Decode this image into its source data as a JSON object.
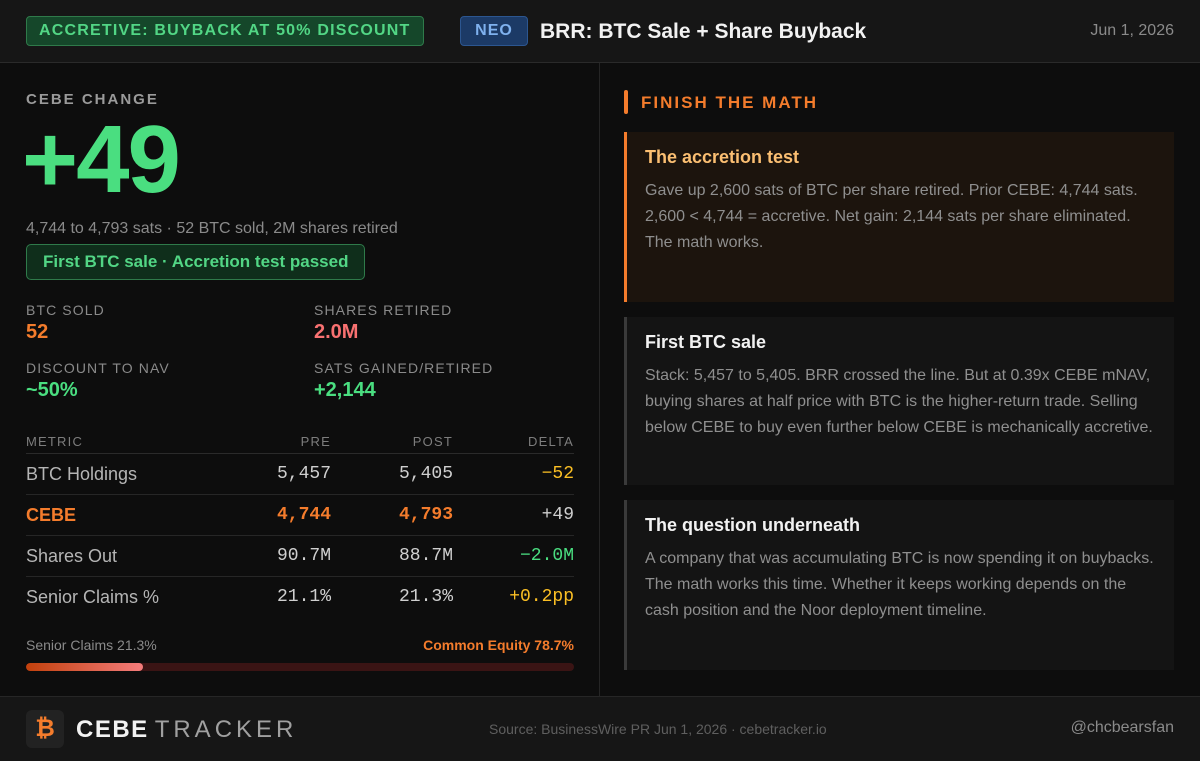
{
  "header": {
    "badge": "ACCRETIVE: BUYBACK AT 50% DISCOUNT",
    "ticker": "NEO",
    "title": "BRR: BTC Sale + Share Buyback",
    "date": "Jun 1, 2026"
  },
  "summary": {
    "label": "CEBE CHANGE",
    "value": "+49",
    "subtitle": "4,744 to 4,793 sats · 52 BTC sold, 2M shares retired",
    "pill": "First BTC sale · Accretion test passed"
  },
  "stats": [
    {
      "label": "BTC SOLD",
      "value": "52",
      "color": "#f47c2c"
    },
    {
      "label": "SHARES RETIRED",
      "value": "2.0M",
      "color": "#f87171"
    },
    {
      "label": "DISCOUNT TO NAV",
      "value": "~50%",
      "color": "#4ade80"
    },
    {
      "label": "SATS GAINED/RETIRED",
      "value": "+2,144",
      "color": "#4ade80"
    }
  ],
  "table": {
    "headers": {
      "metric": "METRIC",
      "pre": "PRE",
      "post": "POST",
      "delta": "DELTA"
    },
    "rows": [
      {
        "metric": "BTC Holdings",
        "pre": "5,457",
        "post": "5,405",
        "delta": "−52",
        "delta_color": "#fbbf24"
      },
      {
        "metric": "CEBE",
        "pre": "4,744",
        "post": "4,793",
        "delta": "+49",
        "delta_color": "#cfcfcf",
        "highlight_color": "#f47c2c"
      },
      {
        "metric": "Shares Out",
        "pre": "90.7M",
        "post": "88.7M",
        "delta": "−2.0M",
        "delta_color": "#4ade80"
      },
      {
        "metric": "Senior Claims %",
        "pre": "21.1%",
        "post": "21.3%",
        "delta": "+0.2pp",
        "delta_color": "#fbbf24"
      }
    ]
  },
  "capital_bar": {
    "left_label": "Senior Claims 21.3%",
    "right_label": "Common Equity 78.7%",
    "senior_fraction": 0.213
  },
  "finish": {
    "title": "FINISH THE MATH",
    "cards": [
      {
        "title": "The accretion test",
        "body": "Gave up 2,600 sats of BTC per share retired. Prior CEBE: 4,744 sats. 2,600 < 4,744 = accretive. Net gain: 2,144 sats per share eliminated. The math works."
      },
      {
        "title": "First BTC sale",
        "body": "Stack: 5,457 to 5,405. BRR crossed the line. But at 0.39x CEBE mNAV, buying shares at half price with BTC is the higher-return trade. Selling below CEBE to buy even further below CEBE is mechanically accretive."
      },
      {
        "title": "The question underneath",
        "body": "A company that was accumulating BTC is now spending it on buybacks. The math works this time. Whether it keeps working depends on the cash position and the Noor deployment timeline."
      }
    ]
  },
  "footer": {
    "logo_glyph": "₿",
    "brand_bold": "CEBE",
    "brand_light": "TRACKER",
    "source": "Source: BusinessWire PR Jun 1, 2026 · cebetracker.io",
    "handle": "@chcbearsfan"
  }
}
